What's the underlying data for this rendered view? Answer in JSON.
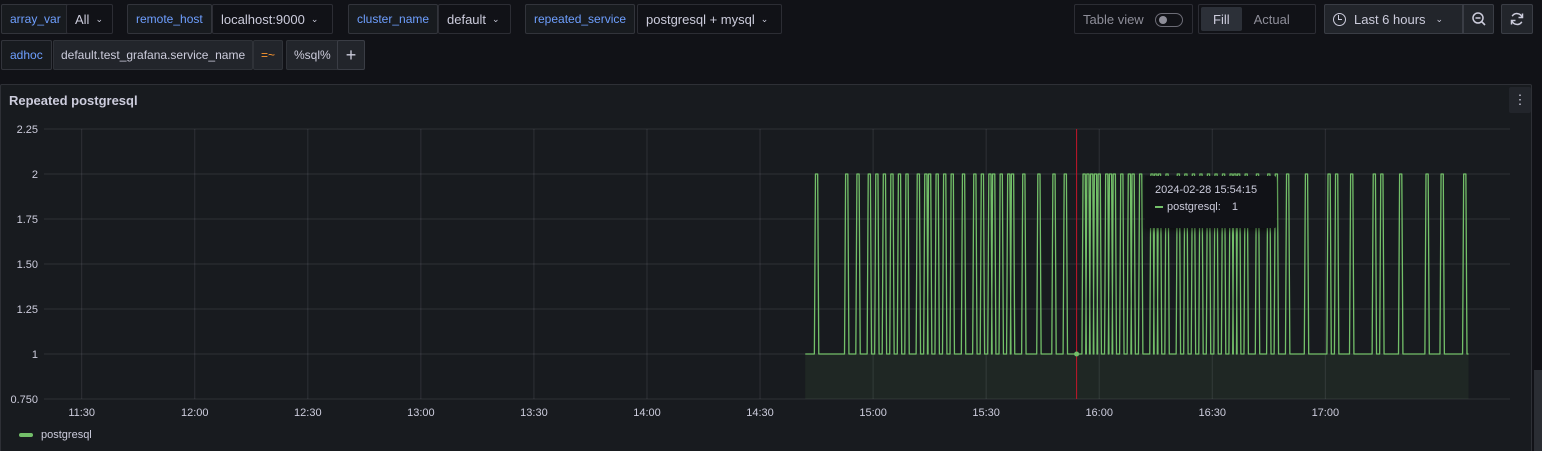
{
  "variables": [
    {
      "label": "array_var",
      "value": "All"
    },
    {
      "label": "remote_host",
      "value": "localhost:9000"
    },
    {
      "label": "cluster_name",
      "value": "default"
    },
    {
      "label": "repeated_service",
      "value": "postgresql + mysql"
    }
  ],
  "adhoc": {
    "label": "adhoc",
    "key": "default.test_grafana.service_name",
    "operator": "=~",
    "value": "%sql%",
    "add_label": "+"
  },
  "toolbar": {
    "table_view_label": "Table view",
    "fill_label": "Fill",
    "actual_label": "Actual",
    "time_range": "Last 6 hours"
  },
  "panel": {
    "title": "Repeated postgresql",
    "menu_icon": "kebab-menu-icon"
  },
  "tooltip": {
    "time": "2024-02-28 15:54:15",
    "series": "postgresql:",
    "value": "1"
  },
  "legend": [
    {
      "name": "postgresql",
      "color": "#73bf69"
    }
  ],
  "chart_data": {
    "type": "line",
    "title": "Repeated postgresql",
    "xlabel": "",
    "ylabel": "",
    "ylim": [
      0.75,
      2.25
    ],
    "y_ticks": [
      "2.25",
      "2",
      "1.75",
      "1.50",
      "1.25",
      "1",
      "0.750"
    ],
    "x_ticks": [
      "11:30",
      "12:00",
      "12:30",
      "13:00",
      "13:30",
      "14:00",
      "14:30",
      "15:00",
      "15:30",
      "16:00",
      "16:30",
      "17:00"
    ],
    "x_range": [
      "11:30",
      "17:43"
    ],
    "cursor_time": "15:54",
    "grid": true,
    "series": [
      {
        "name": "postgresql",
        "color": "#73bf69",
        "baseline": 1,
        "start": "14:42",
        "end": "17:38",
        "spikes_to_2_at": [
          "14:45",
          "14:53",
          "14:56",
          "14:59",
          "15:01",
          "15:03",
          "15:05",
          "15:07",
          "15:09",
          "15:12",
          "15:14",
          "15:15",
          "15:17",
          "15:19",
          "15:21",
          "15:24",
          "15:27",
          "15:29",
          "15:31",
          "15:32",
          "15:34",
          "15:36",
          "15:37",
          "15:40",
          "15:44",
          "15:48",
          "15:51",
          "15:56",
          "15:57",
          "15:58",
          "15:59",
          "16:00",
          "16:02",
          "16:03",
          "16:04",
          "16:06",
          "16:08",
          "16:09",
          "16:11",
          "16:14",
          "16:15",
          "16:16",
          "16:18",
          "16:21",
          "16:23",
          "16:25",
          "16:27",
          "16:29",
          "16:31",
          "16:33",
          "16:35",
          "16:36",
          "16:37",
          "16:39",
          "16:42",
          "16:45",
          "16:47",
          "16:50",
          "16:55",
          "17:01",
          "17:03",
          "17:07",
          "17:13",
          "17:15",
          "17:20",
          "17:27",
          "17:31",
          "17:37"
        ]
      }
    ]
  },
  "colors": {
    "background": "#111217",
    "panel": "#181b1f",
    "accent_blue": "#6e9fff",
    "series_green": "#73bf69",
    "cursor_red": "#c4162a",
    "operator_orange": "#ff9830"
  }
}
